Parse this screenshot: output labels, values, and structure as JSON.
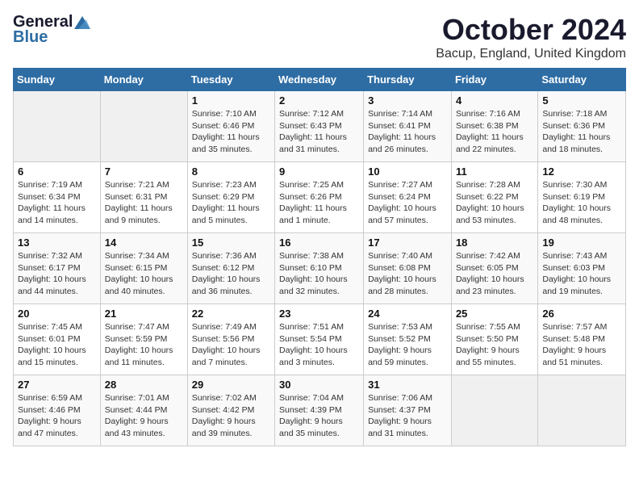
{
  "logo": {
    "general": "General",
    "blue": "Blue"
  },
  "title": "October 2024",
  "location": "Bacup, England, United Kingdom",
  "days_of_week": [
    "Sunday",
    "Monday",
    "Tuesday",
    "Wednesday",
    "Thursday",
    "Friday",
    "Saturday"
  ],
  "weeks": [
    [
      {
        "day": "",
        "info": ""
      },
      {
        "day": "",
        "info": ""
      },
      {
        "day": "1",
        "info": "Sunrise: 7:10 AM\nSunset: 6:46 PM\nDaylight: 11 hours\nand 35 minutes."
      },
      {
        "day": "2",
        "info": "Sunrise: 7:12 AM\nSunset: 6:43 PM\nDaylight: 11 hours\nand 31 minutes."
      },
      {
        "day": "3",
        "info": "Sunrise: 7:14 AM\nSunset: 6:41 PM\nDaylight: 11 hours\nand 26 minutes."
      },
      {
        "day": "4",
        "info": "Sunrise: 7:16 AM\nSunset: 6:38 PM\nDaylight: 11 hours\nand 22 minutes."
      },
      {
        "day": "5",
        "info": "Sunrise: 7:18 AM\nSunset: 6:36 PM\nDaylight: 11 hours\nand 18 minutes."
      }
    ],
    [
      {
        "day": "6",
        "info": "Sunrise: 7:19 AM\nSunset: 6:34 PM\nDaylight: 11 hours\nand 14 minutes."
      },
      {
        "day": "7",
        "info": "Sunrise: 7:21 AM\nSunset: 6:31 PM\nDaylight: 11 hours\nand 9 minutes."
      },
      {
        "day": "8",
        "info": "Sunrise: 7:23 AM\nSunset: 6:29 PM\nDaylight: 11 hours\nand 5 minutes."
      },
      {
        "day": "9",
        "info": "Sunrise: 7:25 AM\nSunset: 6:26 PM\nDaylight: 11 hours\nand 1 minute."
      },
      {
        "day": "10",
        "info": "Sunrise: 7:27 AM\nSunset: 6:24 PM\nDaylight: 10 hours\nand 57 minutes."
      },
      {
        "day": "11",
        "info": "Sunrise: 7:28 AM\nSunset: 6:22 PM\nDaylight: 10 hours\nand 53 minutes."
      },
      {
        "day": "12",
        "info": "Sunrise: 7:30 AM\nSunset: 6:19 PM\nDaylight: 10 hours\nand 48 minutes."
      }
    ],
    [
      {
        "day": "13",
        "info": "Sunrise: 7:32 AM\nSunset: 6:17 PM\nDaylight: 10 hours\nand 44 minutes."
      },
      {
        "day": "14",
        "info": "Sunrise: 7:34 AM\nSunset: 6:15 PM\nDaylight: 10 hours\nand 40 minutes."
      },
      {
        "day": "15",
        "info": "Sunrise: 7:36 AM\nSunset: 6:12 PM\nDaylight: 10 hours\nand 36 minutes."
      },
      {
        "day": "16",
        "info": "Sunrise: 7:38 AM\nSunset: 6:10 PM\nDaylight: 10 hours\nand 32 minutes."
      },
      {
        "day": "17",
        "info": "Sunrise: 7:40 AM\nSunset: 6:08 PM\nDaylight: 10 hours\nand 28 minutes."
      },
      {
        "day": "18",
        "info": "Sunrise: 7:42 AM\nSunset: 6:05 PM\nDaylight: 10 hours\nand 23 minutes."
      },
      {
        "day": "19",
        "info": "Sunrise: 7:43 AM\nSunset: 6:03 PM\nDaylight: 10 hours\nand 19 minutes."
      }
    ],
    [
      {
        "day": "20",
        "info": "Sunrise: 7:45 AM\nSunset: 6:01 PM\nDaylight: 10 hours\nand 15 minutes."
      },
      {
        "day": "21",
        "info": "Sunrise: 7:47 AM\nSunset: 5:59 PM\nDaylight: 10 hours\nand 11 minutes."
      },
      {
        "day": "22",
        "info": "Sunrise: 7:49 AM\nSunset: 5:56 PM\nDaylight: 10 hours\nand 7 minutes."
      },
      {
        "day": "23",
        "info": "Sunrise: 7:51 AM\nSunset: 5:54 PM\nDaylight: 10 hours\nand 3 minutes."
      },
      {
        "day": "24",
        "info": "Sunrise: 7:53 AM\nSunset: 5:52 PM\nDaylight: 9 hours\nand 59 minutes."
      },
      {
        "day": "25",
        "info": "Sunrise: 7:55 AM\nSunset: 5:50 PM\nDaylight: 9 hours\nand 55 minutes."
      },
      {
        "day": "26",
        "info": "Sunrise: 7:57 AM\nSunset: 5:48 PM\nDaylight: 9 hours\nand 51 minutes."
      }
    ],
    [
      {
        "day": "27",
        "info": "Sunrise: 6:59 AM\nSunset: 4:46 PM\nDaylight: 9 hours\nand 47 minutes."
      },
      {
        "day": "28",
        "info": "Sunrise: 7:01 AM\nSunset: 4:44 PM\nDaylight: 9 hours\nand 43 minutes."
      },
      {
        "day": "29",
        "info": "Sunrise: 7:02 AM\nSunset: 4:42 PM\nDaylight: 9 hours\nand 39 minutes."
      },
      {
        "day": "30",
        "info": "Sunrise: 7:04 AM\nSunset: 4:39 PM\nDaylight: 9 hours\nand 35 minutes."
      },
      {
        "day": "31",
        "info": "Sunrise: 7:06 AM\nSunset: 4:37 PM\nDaylight: 9 hours\nand 31 minutes."
      },
      {
        "day": "",
        "info": ""
      },
      {
        "day": "",
        "info": ""
      }
    ]
  ]
}
